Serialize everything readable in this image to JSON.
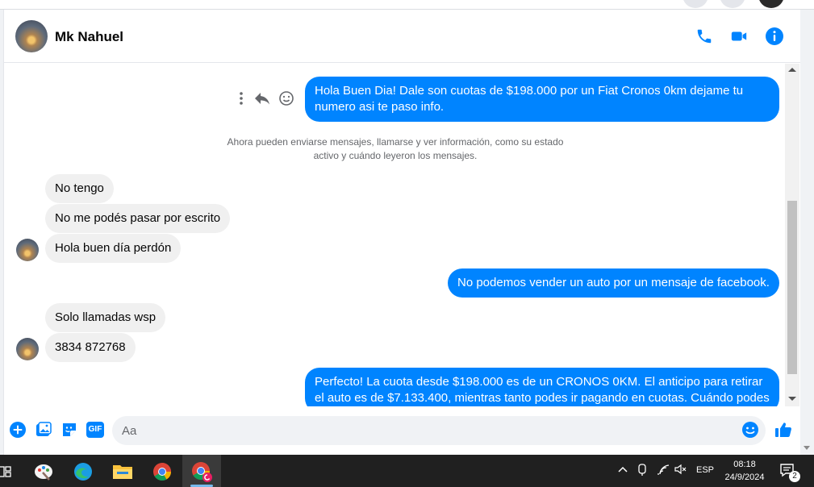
{
  "colors": {
    "accent": "#0084ff",
    "incoming_bubble": "#f0f0f0",
    "outgoing_text": "#ffffff",
    "taskbar": "#202020"
  },
  "header": {
    "contact_name": "Mk Nahuel",
    "icons": [
      "phone-icon",
      "video-camera-icon",
      "info-icon"
    ]
  },
  "messages": {
    "outgoing_1": "Hola Buen Dia! Dale son cuotas de $198.000 por un Fiat Cronos 0km dejame tu numero asi te paso info.",
    "system_note": "Ahora pueden enviarse mensajes, llamarse y ver información, como su estado activo y cuándo leyeron los mensajes.",
    "incoming_1": "No tengo",
    "incoming_2": "No me podés pasar por escrito",
    "incoming_3": "Hola buen día perdón",
    "outgoing_2": "No podemos vender un auto por un mensaje de facebook.",
    "incoming_4": "Solo llamadas wsp",
    "incoming_5": "3834 872768",
    "outgoing_3": "Perfecto! La cuota desde $198.000 es de un CRONOS 0KM. El anticipo para retirar el auto es de $7.133.400, mientras tanto podes ir pagando en cuotas. Cuándo podes"
  },
  "composer": {
    "placeholder": "Aa",
    "icons": [
      "plus-circle-icon",
      "photo-icon",
      "sticker-icon",
      "gif-icon",
      "emoji-icon",
      "thumbs-up-icon"
    ],
    "gif_label": "GIF"
  },
  "taskbar": {
    "apps": [
      "task-view-icon",
      "paint-icon",
      "edge-icon",
      "file-explorer-icon",
      "chrome-icon",
      "chrome-profile-icon"
    ],
    "language": "ESP",
    "time": "08:18",
    "date": "24/9/2024",
    "notification_count": "2"
  }
}
